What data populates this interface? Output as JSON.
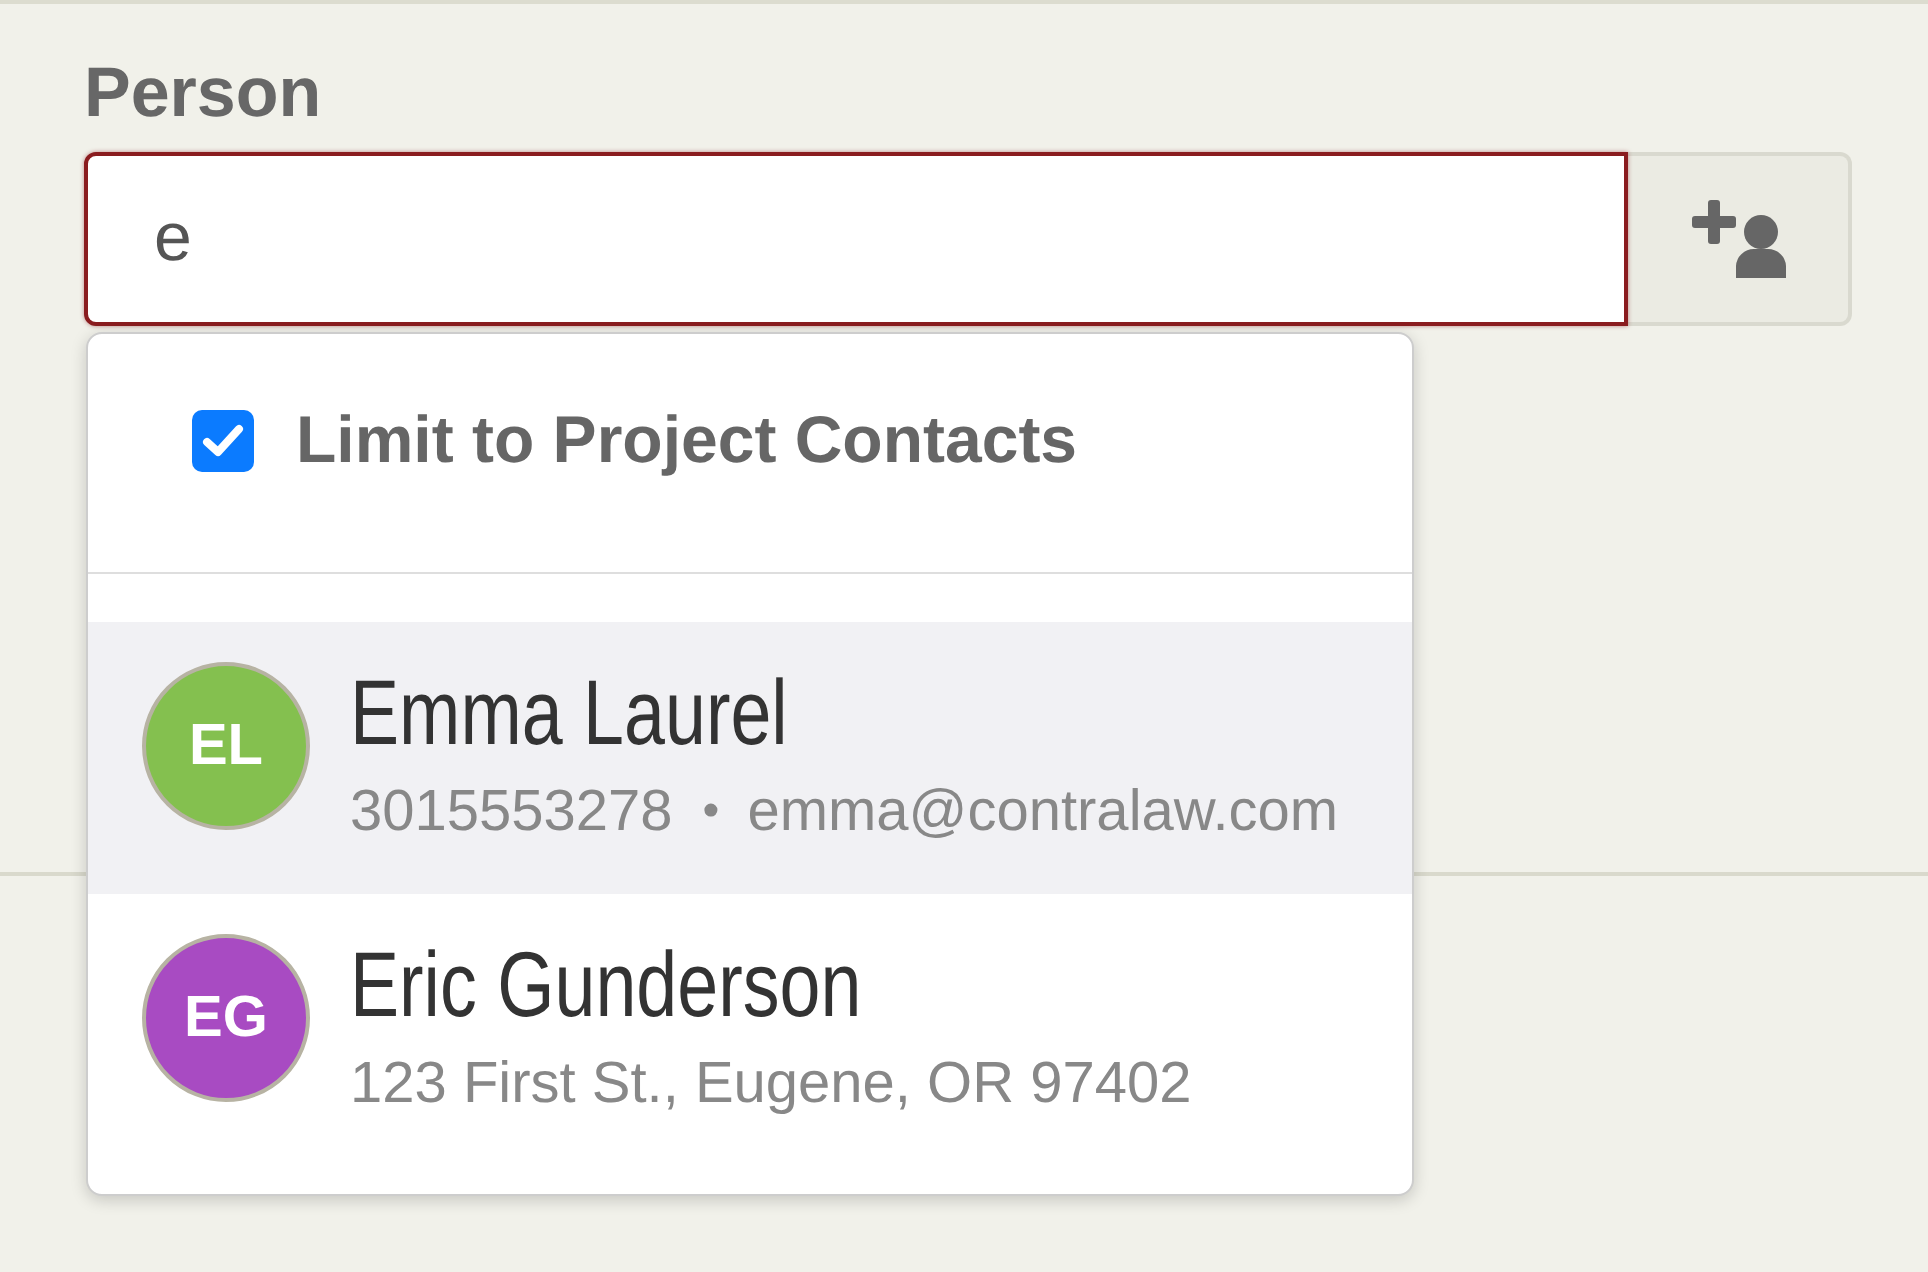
{
  "field": {
    "label": "Person",
    "value": "e",
    "invalid": true
  },
  "dropdown": {
    "limit_option": {
      "label": "Limit to Project Contacts",
      "checked": true
    },
    "detail_separator": "•",
    "results": [
      {
        "initials": "EL",
        "color": "#84c04f",
        "name": "Emma Laurel",
        "details": [
          "3015553278",
          "emma@contralaw.com"
        ],
        "selected": true
      },
      {
        "initials": "EG",
        "color": "#a84bc2",
        "name": "Eric Gunderson",
        "details": [
          "123 First St., Eugene, OR 97402"
        ],
        "selected": false
      }
    ]
  }
}
